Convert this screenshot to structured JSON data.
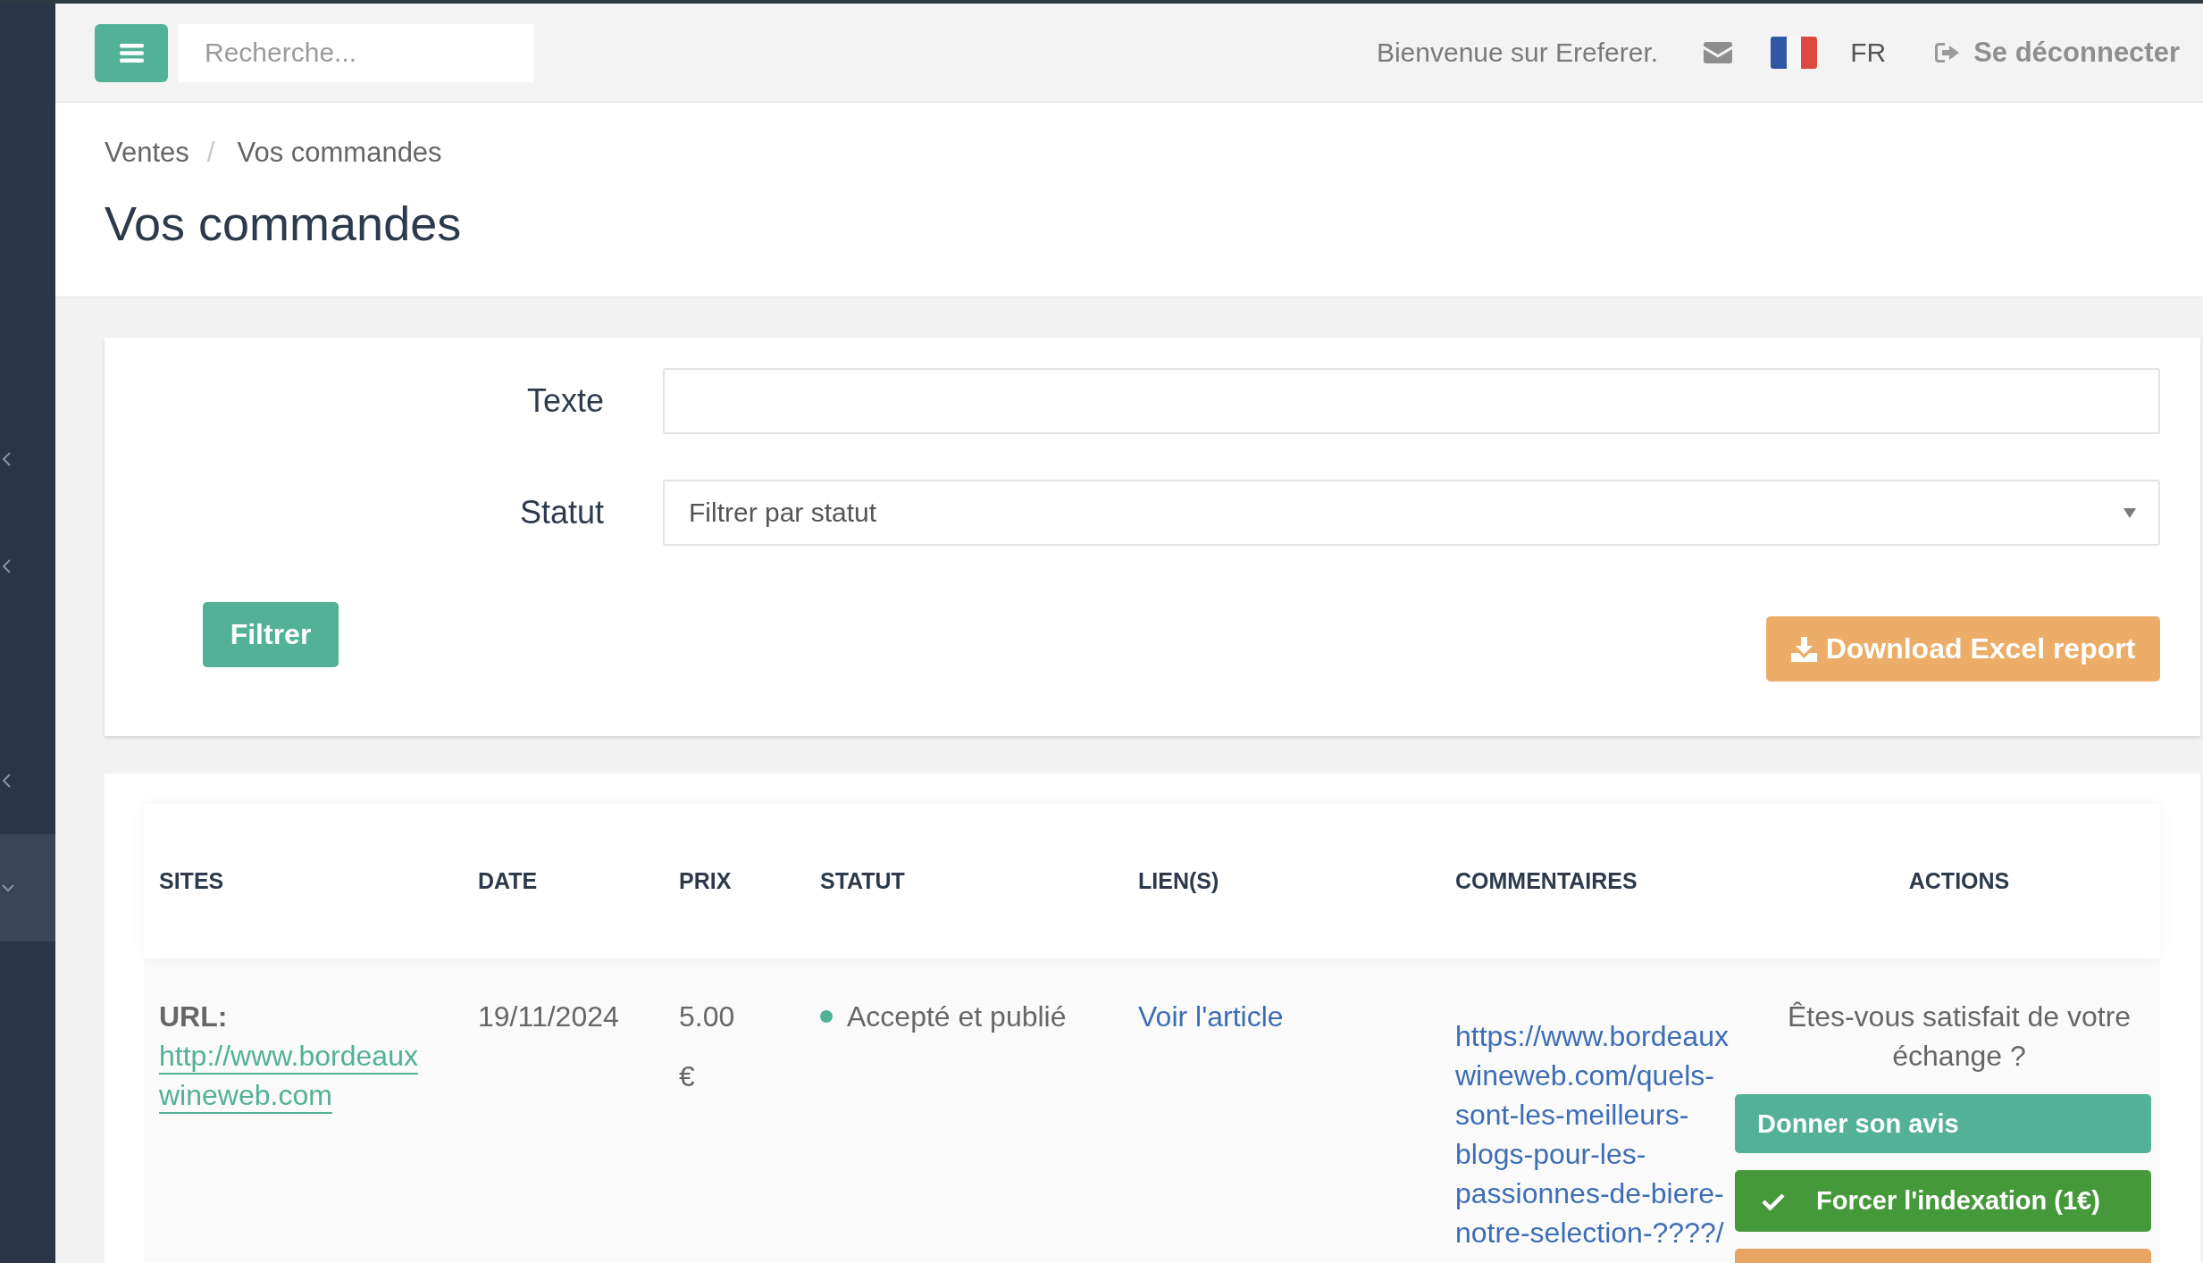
{
  "sidebar": {
    "items": [
      {
        "kind": "group",
        "expanded": false,
        "selected": false
      },
      {
        "kind": "group",
        "expanded": false,
        "selected": false
      },
      {
        "kind": "link",
        "selected": false
      },
      {
        "kind": "group",
        "expanded": false,
        "selected": false
      },
      {
        "kind": "group",
        "expanded": true,
        "selected": true
      }
    ]
  },
  "topbar": {
    "search": {
      "placeholder": "Recherche..."
    },
    "welcome": "Bienvenue sur Ereferer.",
    "language": "FR",
    "logout": "Se déconnecter"
  },
  "page": {
    "breadcrumb": {
      "items": [
        "Ventes",
        "Vos commandes"
      ],
      "separator": "/"
    },
    "title": "Vos commandes"
  },
  "filters": {
    "fields": [
      {
        "kind": "text",
        "label": "Texte"
      },
      {
        "kind": "select",
        "label": "Statut",
        "value": "Filtrer par statut"
      }
    ],
    "submit": "Filtrer",
    "export": "Download Excel report"
  },
  "table": {
    "columns": [
      "SITES",
      "DATE",
      "PRIX",
      "STATUT",
      "LIEN(S)",
      "COMMENTAIRES",
      "ACTIONS"
    ],
    "rows": [
      {
        "site": {
          "label": "URL:",
          "url": "http://www.bordeauxwineweb.com"
        },
        "date": "19/11/2024",
        "price": {
          "amount": "5.00",
          "currency": "€"
        },
        "status": {
          "label": "Accepté et publié",
          "color": "#52b196"
        },
        "link": "Voir l'article",
        "comment": "https://www.bordeauxwineweb.com/quels-sont-les-meilleurs-blogs-pour-les-passionnes-de-biere-notre-selection-????/",
        "feedback": {
          "question": "Êtes-vous satisfait de votre échange ?",
          "actions": [
            {
              "kind": "review",
              "label": "Donner son avis"
            },
            {
              "kind": "index",
              "label": "Forcer l'indexation (1€)"
            },
            {
              "kind": "secondary"
            }
          ]
        }
      }
    ]
  }
}
